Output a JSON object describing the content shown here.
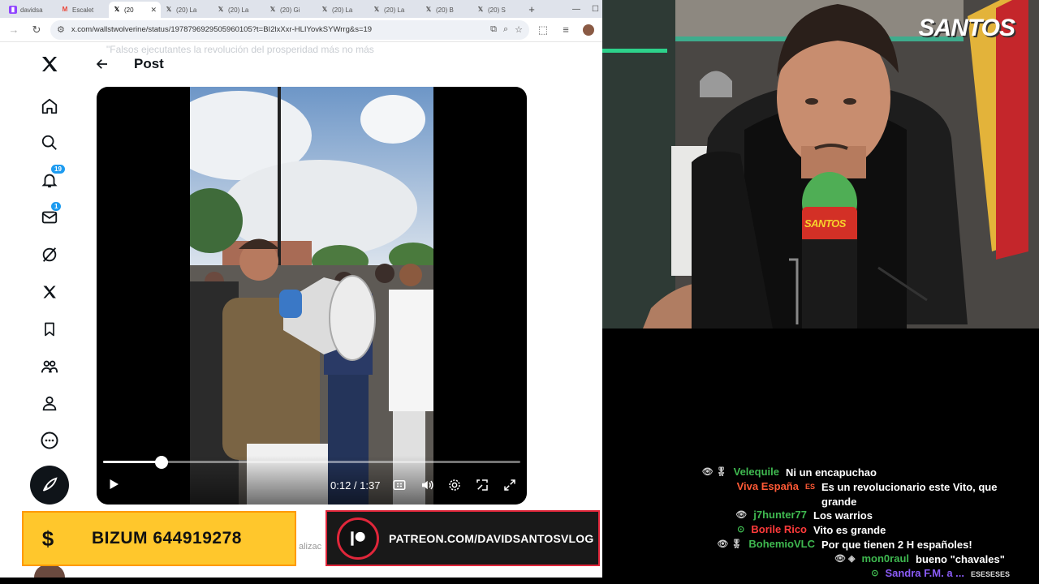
{
  "browser": {
    "tabs": [
      {
        "label": "davidsa",
        "icon": "twitch-icon",
        "active": false
      },
      {
        "label": "Escalet",
        "icon": "gmail-icon",
        "active": false
      },
      {
        "label": "(20",
        "icon": "x-icon",
        "active": true
      },
      {
        "label": "(20) La",
        "icon": "x-icon",
        "active": false
      },
      {
        "label": "(20) La",
        "icon": "x-icon",
        "active": false
      },
      {
        "label": "(20) Gi",
        "icon": "x-icon",
        "active": false
      },
      {
        "label": "(20) La",
        "icon": "x-icon",
        "active": false
      },
      {
        "label": "(20) La",
        "icon": "x-icon",
        "active": false
      },
      {
        "label": "(20) B",
        "icon": "x-icon",
        "active": false
      },
      {
        "label": "(20) S",
        "icon": "x-icon",
        "active": false
      }
    ],
    "url": "x.com/wallstwolverine/status/1978796929505960105?t=BI2lxXxr-HLIYovkSYWrrg&s=19"
  },
  "x": {
    "nav": [
      {
        "name": "x-logo-icon"
      },
      {
        "name": "home-icon"
      },
      {
        "name": "search-icon"
      },
      {
        "name": "notifications-icon",
        "badge": "19"
      },
      {
        "name": "messages-icon",
        "badge": "1"
      },
      {
        "name": "grok-icon"
      },
      {
        "name": "premium-x-icon"
      },
      {
        "name": "bookmarks-icon"
      },
      {
        "name": "communities-icon"
      },
      {
        "name": "profile-icon"
      },
      {
        "name": "more-icon"
      }
    ],
    "post_title": "Post",
    "ghost_text": "\"Falsos ejecutantes la revolución del prosperidad más no más",
    "video": {
      "time": "0:12 / 1:37",
      "progress": 0.14
    },
    "behind_text": "alizac"
  },
  "overlays": {
    "bizum_symbol": "$",
    "bizum_text": "BIZUM 644919278",
    "patreon_text": "PATREON.COM/DAVIDSANTOSVLOG"
  },
  "webcam": {
    "logo": "SANTOS",
    "mic_label": "SANTOS"
  },
  "chat": {
    "messages": [
      {
        "badges": "👁 🎖",
        "user": "Velequile",
        "color": "#3fb950",
        "text": "Ni un encapuchao"
      },
      {
        "badges": "",
        "user": "Viva España",
        "suffix": "ES",
        "color": "#ff5a36",
        "text": "Es un revolucionario este Vito, que grande"
      },
      {
        "badges": "👁",
        "user": "j7hunter77",
        "color": "#3fb950",
        "text": "Los warrios"
      },
      {
        "badges": "⊙",
        "user": "Borile Rico",
        "color": "#ff3b3b",
        "text": "Vito es grande"
      },
      {
        "badges": "👁 🎖",
        "user": "BohemioVLC",
        "color": "#3fb950",
        "text": "Por que tienen 2 H españoles!"
      },
      {
        "badges": "👁 ◈",
        "user": "mon0raul",
        "color": "#3fb950",
        "text": "bueno \"chavales\""
      },
      {
        "badges": "⊙",
        "user": "Sandra F.M. a ...",
        "color": "#8b5cf6",
        "text": "ESESESES"
      }
    ]
  }
}
